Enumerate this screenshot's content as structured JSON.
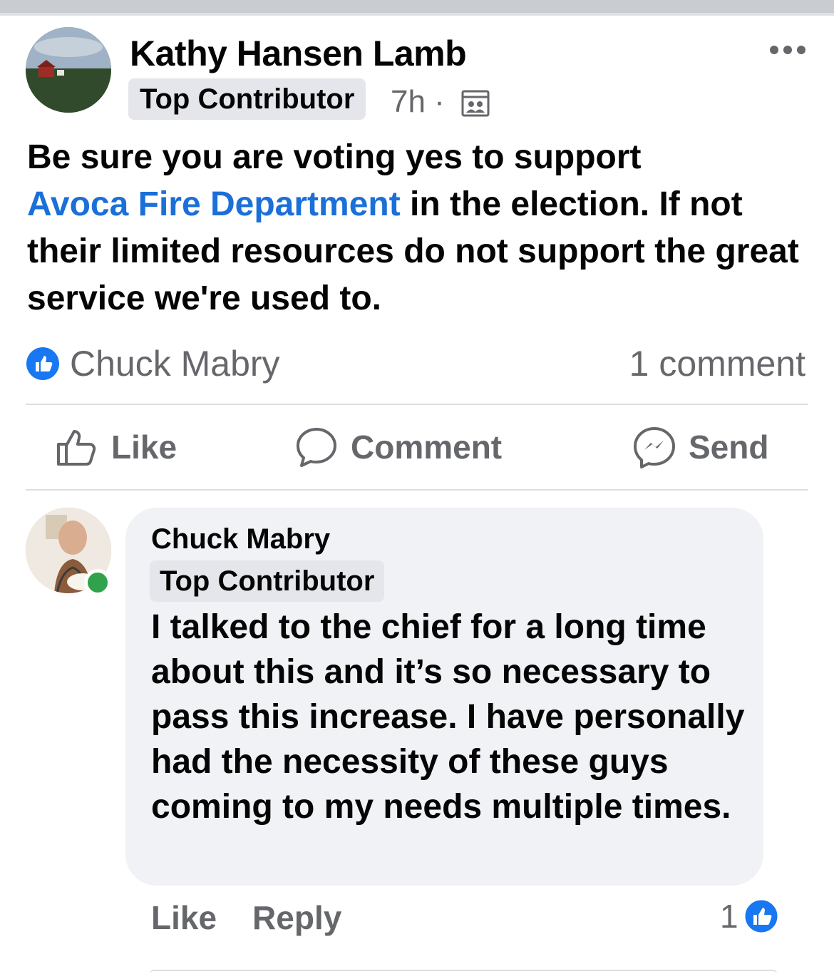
{
  "post": {
    "author": "Kathy Hansen Lamb",
    "badge": "Top Contributor",
    "time": "7h ·",
    "body_line1": "Be sure you are voting yes to support",
    "link_text": "Avoca Fire Department",
    "body_rest": " in the election.  If not their limited resources do not support the great service we're used to.",
    "reactor": "Chuck Mabry",
    "comment_count": "1 comment"
  },
  "actions": {
    "like": "Like",
    "comment": "Comment",
    "send": "Send"
  },
  "comment": {
    "author": "Chuck Mabry",
    "badge": "Top Contributor",
    "text": "I talked to the chief for a long time about this and it’s so necessary to pass this increase. I have personally had the necessity of these guys coming to my needs multiple times.",
    "like": "Like",
    "reply": "Reply",
    "reaction_count": "1"
  },
  "colors": {
    "link": "#1a6fd8",
    "like_blue": "#1877f2",
    "secondary_text": "#65676b",
    "bubble_bg": "#f0f2f5",
    "online": "#31a24c"
  },
  "icons": [
    "more-icon",
    "audience-icon",
    "like-reaction-icon",
    "thumbs-up-icon",
    "comment-icon",
    "messenger-icon"
  ]
}
